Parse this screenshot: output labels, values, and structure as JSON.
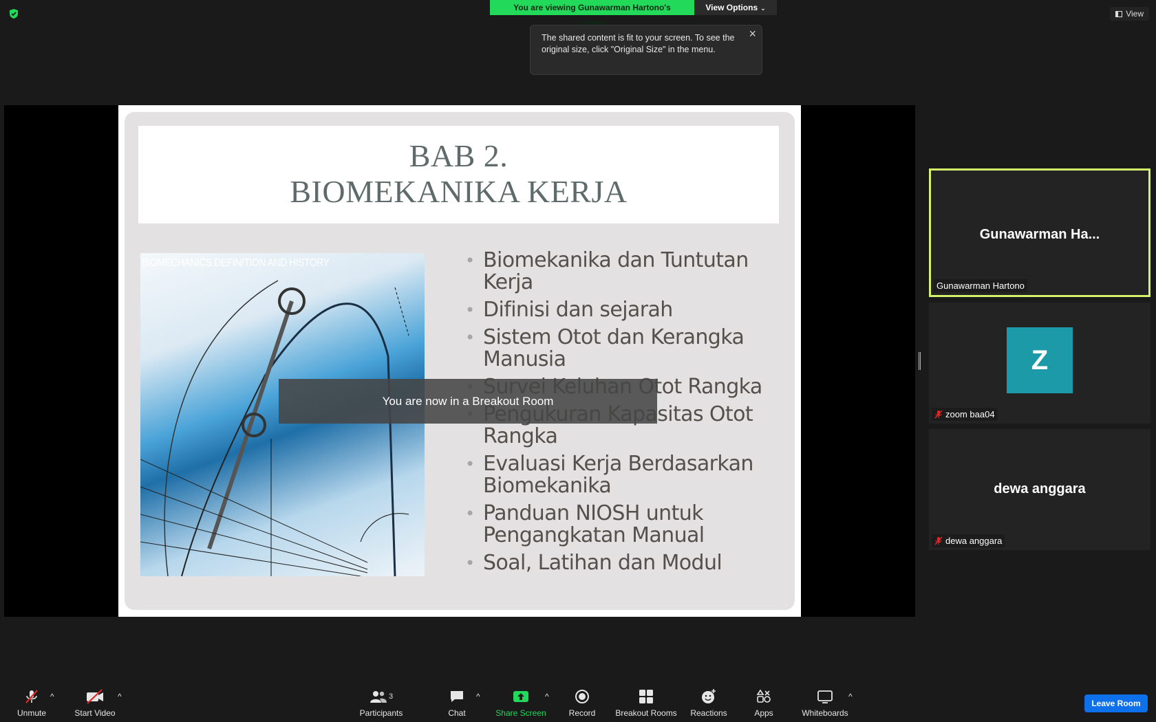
{
  "top": {
    "viewing_banner": "You are viewing Gunawarman Hartono's screen",
    "view_options_label": "View Options",
    "view_label": "View",
    "fit_tooltip": "The shared content is fit to your screen. To see the original size, click \"Original Size\" in the menu."
  },
  "slide": {
    "title_line1": "BAB 2.",
    "title_line2": "BIOMEKANIKA KERJA",
    "image_caption": "BIOMECHANICS DEFINITION AND HISTORY",
    "bullets": [
      "Biomekanika dan Tuntutan Kerja",
      "Difinisi dan sejarah",
      "Sistem Otot dan Kerangka Manusia",
      "Survei Keluhan Otot Rangka",
      "Pengukuran Kapasitas Otot Rangka",
      "Evaluasi Kerja Berdasarkan Biomekanika",
      "Panduan NIOSH untuk Pengangkatan Manual",
      "Soal, Latihan dan Modul"
    ]
  },
  "breakout_toast": "You are now in a Breakout Room",
  "participants": [
    {
      "display": "Gunawarman  Ha...",
      "label": "Gunawarman Hartono",
      "active": true
    },
    {
      "avatar_letter": "Z",
      "label": "zoom baa04",
      "muted": true
    },
    {
      "display": "dewa anggara",
      "label": "dewa anggara",
      "muted": true
    }
  ],
  "toolbar": {
    "unmute": "Unmute",
    "start_video": "Start Video",
    "participants": "Participants",
    "participants_count": "3",
    "chat": "Chat",
    "share_screen": "Share Screen",
    "record": "Record",
    "breakout_rooms": "Breakout Rooms",
    "reactions": "Reactions",
    "apps": "Apps",
    "whiteboards": "Whiteboards",
    "leave_room": "Leave Room"
  },
  "colors": {
    "share_banner": "#23d959",
    "active_speaker_border": "#d6f26a",
    "leave_button": "#0e71eb",
    "avatar_bg": "#1c9aa8"
  }
}
